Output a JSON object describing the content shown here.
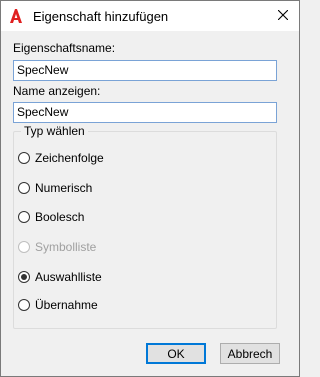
{
  "dialog": {
    "title": "Eigenschaft hinzufügen",
    "brand_color": "#e02020",
    "close_icon": "close-icon"
  },
  "property_name": {
    "label": "Eigenschaftsname:",
    "value": "SpecNew"
  },
  "display_name": {
    "label": "Name anzeigen:",
    "value": "SpecNew"
  },
  "type_group": {
    "legend": "Typ wählen",
    "options": [
      {
        "label": "Zeichenfolge",
        "checked": false,
        "enabled": true
      },
      {
        "label": "Numerisch",
        "checked": false,
        "enabled": true
      },
      {
        "label": "Boolesch",
        "checked": false,
        "enabled": true
      },
      {
        "label": "Symbolliste",
        "checked": false,
        "enabled": false
      },
      {
        "label": "Auswahlliste",
        "checked": true,
        "enabled": true
      },
      {
        "label": "Übernahme",
        "checked": false,
        "enabled": true
      }
    ]
  },
  "buttons": {
    "ok_label": "OK",
    "cancel_label": "Abbrech"
  }
}
